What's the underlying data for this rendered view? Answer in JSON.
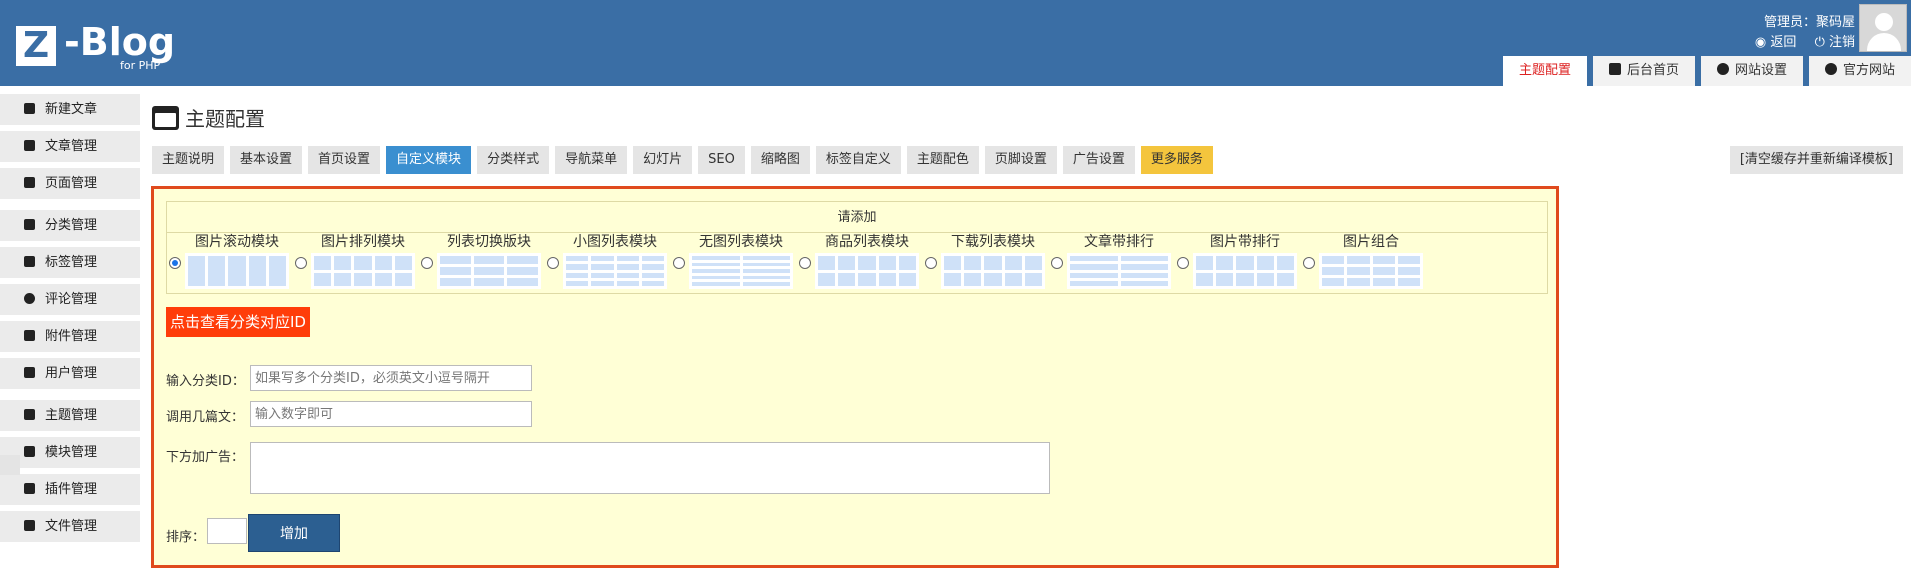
{
  "brand": {
    "logo_letter": "Z",
    "logo_text": "-Blog",
    "logo_sub": "for PHP"
  },
  "user": {
    "label": "管理员：聚码屋",
    "back": "返回",
    "logout": "注销"
  },
  "topnav": [
    {
      "label": "主题配置",
      "icon": "theme-icon"
    },
    {
      "label": "后台首页",
      "icon": "home-icon"
    },
    {
      "label": "网站设置",
      "icon": "gear-icon"
    },
    {
      "label": "官方网站",
      "icon": "zblog-icon"
    }
  ],
  "leftmenu": [
    {
      "label": "新建文章",
      "icon": "edit-icon"
    },
    {
      "label": "文章管理",
      "icon": "article-icon"
    },
    {
      "label": "页面管理",
      "icon": "page-icon"
    },
    {
      "label": "分类管理",
      "icon": "folder-icon"
    },
    {
      "label": "标签管理",
      "icon": "tag-icon"
    },
    {
      "label": "评论管理",
      "icon": "comment-icon"
    },
    {
      "label": "附件管理",
      "icon": "attachment-icon"
    },
    {
      "label": "用户管理",
      "icon": "users-icon"
    },
    {
      "label": "主题管理",
      "icon": "theme-manage-icon"
    },
    {
      "label": "模块管理",
      "icon": "module-icon"
    },
    {
      "label": "插件管理",
      "icon": "plugin-icon"
    },
    {
      "label": "文件管理",
      "icon": "file-icon"
    }
  ],
  "page": {
    "title": "主题配置"
  },
  "subtabs": [
    "主题说明",
    "基本设置",
    "首页设置",
    "自定义模块",
    "分类样式",
    "导航菜单",
    "幻灯片",
    "SEO",
    "缩略图",
    "标签自定义",
    "主题配色",
    "页脚设置",
    "广告设置",
    "更多服务"
  ],
  "clear_cache": "[清空缓存并重新编译模板]",
  "addbox": {
    "caption": "请添加",
    "modules": [
      "图片滚动模块",
      "图片排列模块",
      "列表切换版块",
      "小图列表模块",
      "无图列表模块",
      "商品列表模块",
      "下载列表模块",
      "文章带排行",
      "图片带排行",
      "图片组合"
    ]
  },
  "form": {
    "catid_button": "点击查看分类对应ID",
    "catid_label": "输入分类ID：",
    "catid_placeholder": "如果写多个分类ID，必须英文小逗号隔开",
    "count_label": "调用几篇文：",
    "count_placeholder": "输入数字即可",
    "ad_label": "下方加广告：",
    "order_label": "排序：",
    "add_button": "增加"
  },
  "colors": {
    "header": "#3a6ea5",
    "active_tab": "#3a8fd0",
    "panel_bg": "#ffffd6",
    "panel_border": "#e04a1d",
    "accent_button": "#ff3d0a"
  }
}
